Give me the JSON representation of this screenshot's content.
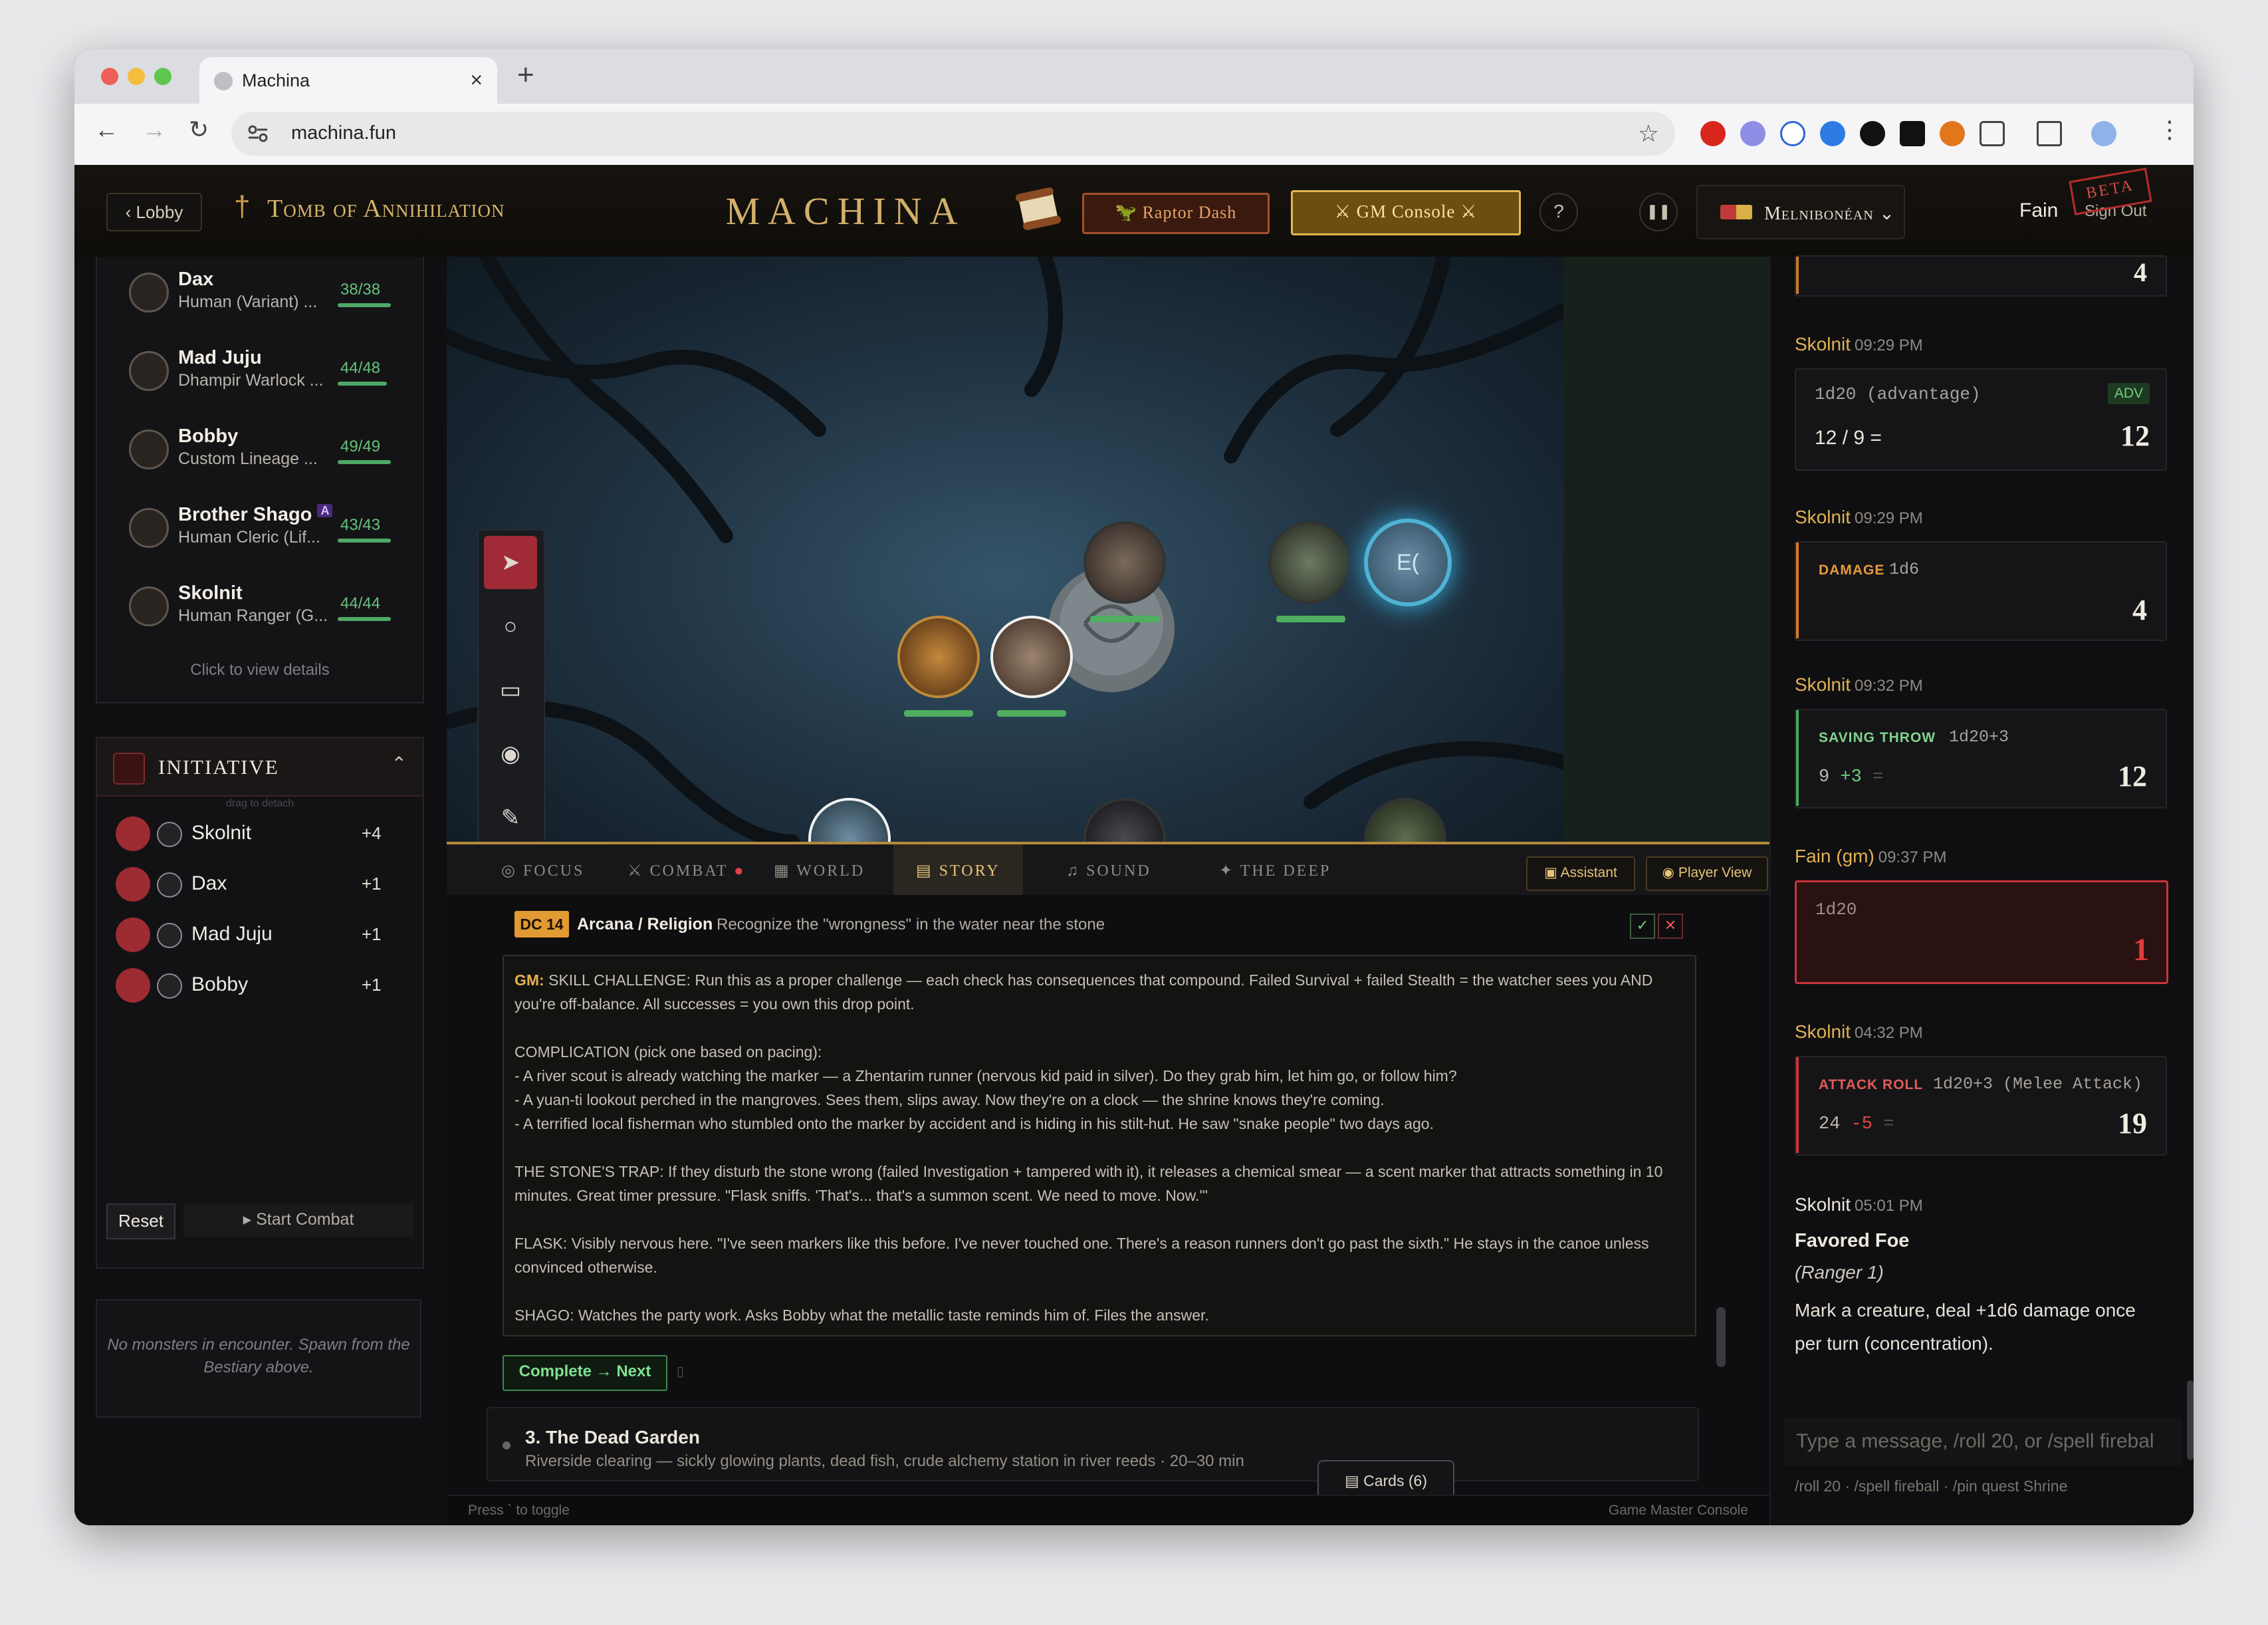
{
  "browser": {
    "tab_title": "Machina",
    "url": "machina.fun"
  },
  "header": {
    "lobby": "Lobby",
    "campaign": "Tomb of Annihilation",
    "logo": "MACHINA",
    "raptor": "Raptor Dash",
    "gm_console": "GM Console",
    "help": "?",
    "world": "Melnibonéan",
    "user": "Fain",
    "sign_out": "Sign Out",
    "beta": "BETA"
  },
  "party": {
    "members": [
      {
        "name": "Dax",
        "sub": "Human (Variant) ...",
        "hp": "38/38"
      },
      {
        "name": "Mad Juju",
        "sub": "Dhampir Warlock ...",
        "hp": "44/48"
      },
      {
        "name": "Bobby",
        "sub": "Custom Lineage ...",
        "hp": "49/49"
      },
      {
        "name": "Brother Shago",
        "sub": "Human Cleric (Lif...",
        "hp": "43/43",
        "badge": "A"
      },
      {
        "name": "Skolnit",
        "sub": "Human Ranger (G...",
        "hp": "44/44"
      }
    ],
    "hint": "Click to view details"
  },
  "initiative": {
    "title": "INITIATIVE",
    "drag": "drag to detach",
    "rows": [
      {
        "name": "Skolnit",
        "bonus": "+4"
      },
      {
        "name": "Dax",
        "bonus": "+1"
      },
      {
        "name": "Mad Juju",
        "bonus": "+1"
      },
      {
        "name": "Bobby",
        "bonus": "+1"
      }
    ],
    "reset": "Reset",
    "start": "Start Combat"
  },
  "encounter": {
    "empty": "No monsters in encounter. Spawn from the Bestiary above."
  },
  "map": {
    "token_label": "E("
  },
  "gm_tabs": {
    "tabs": [
      "FOCUS",
      "COMBAT",
      "WORLD",
      "STORY",
      "SOUND",
      "THE DEEP"
    ],
    "assistant": "Assistant",
    "player_view": "Player View"
  },
  "story": {
    "dc": "DC 14",
    "skill": "Arcana / Religion",
    "skill_desc": "Recognize the \"wrongness\" in the water near the stone",
    "gm_label": "GM:",
    "gm_text": " SKILL CHALLENGE: Run this as a proper challenge — each check has consequences that compound. Failed Survival + failed Stealth = the watcher sees you AND you're off-balance. All successes = you own this drop point.",
    "complication": "COMPLICATION (pick one based on pacing):\n- A river scout is already watching the marker — a Zhentarim runner (nervous kid paid in silver). Do they grab him, let him go, or follow him?\n- A yuan-ti lookout perched in the mangroves. Sees them, slips away. Now they're on a clock — the shrine knows they're coming.\n- A terrified local fisherman who stumbled onto the marker by accident and is hiding in his stilt-hut. He saw \"snake people\" two days ago.",
    "trap": "THE STONE'S TRAP: If they disturb the stone wrong (failed Investigation + tampered with it), it releases a chemical smear — a scent marker that attracts something in 10 minutes. Great timer pressure. \"Flask sniffs. 'That's... that's a summon scent. We need to move. Now.'\"",
    "flask": "FLASK: Visibly nervous here. \"I've seen markers like this before. I've never touched one. There's a reason runners don't go past the sixth.\" He stays in the canoe unless convinced otherwise.",
    "shago": "SHAGO: Watches the party work. Asks Bobby what the metallic taste reminds him of. Files the answer.",
    "complete": "Complete → Next",
    "next_title": "3. The Dead Garden",
    "next_sub": "Riverside clearing — sickly glowing plants, dead fish, crude alchemy station in river reeds · 20–30 min",
    "cards": "Cards (6)",
    "press_hint": "Press ` to toggle",
    "console_label": "Game Master Console"
  },
  "chat": {
    "top_result": "4",
    "entries": [
      {
        "name": "Skolnit",
        "time": "09:29 PM",
        "formula": "1d20 (advantage)",
        "tag": "ADV",
        "detail": "12 / 9 =",
        "result": "12"
      },
      {
        "name": "Skolnit",
        "time": "09:29 PM",
        "label": "DAMAGE",
        "formula": "1d6",
        "result": "4"
      },
      {
        "name": "Skolnit",
        "time": "09:32 PM",
        "label": "SAVING THROW",
        "formula": "1d20+3",
        "detail_a": "9",
        "detail_b": "+3",
        "detail_c": "=",
        "result": "12"
      },
      {
        "name": "Fain (gm)",
        "time": "09:37 PM",
        "formula": "1d20",
        "result": "1"
      },
      {
        "name": "Skolnit",
        "time": "04:32 PM",
        "label": "ATTACK ROLL",
        "formula": "1d20+3 (Melee Attack)",
        "detail_a": "24",
        "detail_b": "-5",
        "detail_c": "=",
        "result": "19"
      },
      {
        "name": "Skolnit",
        "time": "05:01 PM",
        "title": "Favored Foe",
        "subtitle": "(Ranger 1)",
        "text": "Mark a creature, deal +1d6 damage once per turn (concentration)."
      }
    ],
    "placeholder": "Type a message, /roll 20, or /spell firebal",
    "hint": "/roll 20 · /spell fireball · /pin quest Shrine"
  },
  "colors": {
    "accent": "#e2b252",
    "danger": "#c9343a",
    "hp": "#4ea866"
  }
}
